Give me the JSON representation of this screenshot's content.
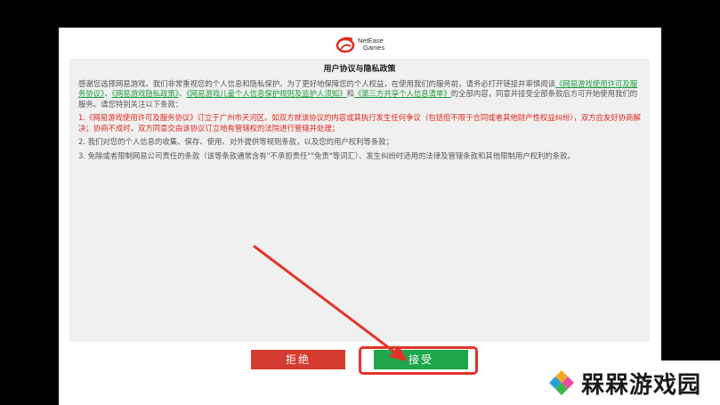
{
  "logo": {
    "line1": "NetEase",
    "line2": "Games",
    "icon": "netease-games-logo-icon",
    "color": "#e0261b"
  },
  "agreement": {
    "title": "用户协议与隐私政策",
    "intro_text": "感谢您选择网易游戏。我们非常重视您的个人信息和隐私保护。为了更好地保障您的个人权益，在使用我们的服务前，请务必打开链接并审慎阅读",
    "link1": "《网易游戏使用许可及服务协议》",
    "sep1": "、",
    "link2": "《网易游戏隐私政策》",
    "sep2": "、",
    "link3": "《网易游戏儿童个人信息保护规则及监护人须知》",
    "sep3": "和",
    "link4": "《第三方共享个人信息清单》",
    "intro_end": "的全部内容，同意并接受全部条款后方可开始使用我们的服务。请您特别关注以下条款：",
    "clause1": "1.《网易游戏使用许可及服务协议》订立于广州市天河区。如双方就该协议的内容或其执行发生任何争议（包括但不限于合同或者其他财产性权益纠纷），双方应友好协商解决；协商不成时，双方同意交由该协议订立地有管辖权的法院进行管辖并处理；",
    "clause2": "2. 我们对您的个人信息的收集、保存、使用、对外提供等规则条款，以及您的用户权利等条款；",
    "clause3": "3. 免除或者限制网易公司责任的条款（该等条款通常含有\"不承担责任\"\"免责\"等词汇）、发生纠纷时适用的法律及管辖条款和其他限制用户权利的条款。"
  },
  "buttons": {
    "reject": "拒绝",
    "accept": "接受"
  },
  "watermark": {
    "text": "槑槑游戏园",
    "icon": "colorful-diamond-logo-icon"
  },
  "colors": {
    "accept": "#1fa64a",
    "reject": "#d63b2f",
    "link": "#1a9c3c",
    "warning": "#e0261b",
    "annotation": "#e0342a"
  }
}
